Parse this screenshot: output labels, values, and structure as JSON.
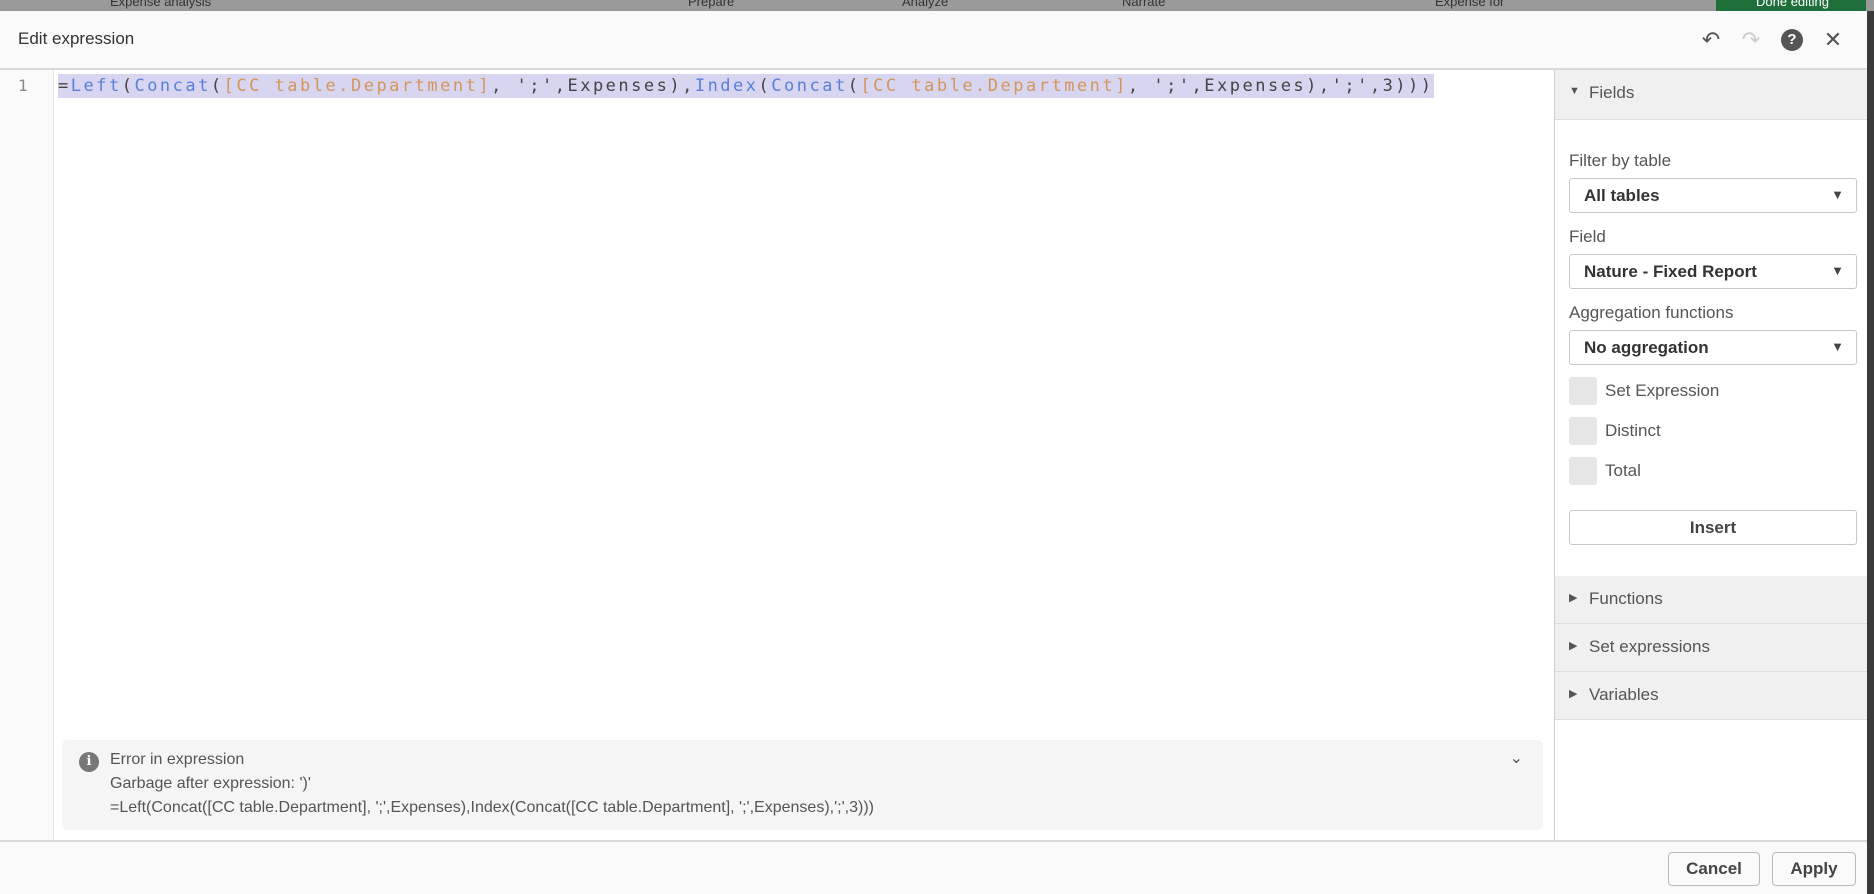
{
  "app_bar": {
    "title": "Expense analysis",
    "tabs": [
      "Prepare",
      "Analyze",
      "Narrate"
    ],
    "sheet": "Expense for",
    "done_label": "Done editing"
  },
  "dialog": {
    "title": "Edit expression",
    "header_icons": [
      "undo-icon",
      "redo-icon",
      "help-icon",
      "close-icon"
    ]
  },
  "editor": {
    "line_number": "1",
    "tokens": [
      {
        "t": "=",
        "c": "str"
      },
      {
        "t": "Left",
        "c": "fn"
      },
      {
        "t": "(",
        "c": "str"
      },
      {
        "t": "Concat",
        "c": "fn"
      },
      {
        "t": "(",
        "c": "str"
      },
      {
        "t": "[CC table.Department]",
        "c": "fld"
      },
      {
        "t": ", ';',Expenses),",
        "c": "str"
      },
      {
        "t": "Index",
        "c": "fn"
      },
      {
        "t": "(",
        "c": "str"
      },
      {
        "t": "Concat",
        "c": "fn"
      },
      {
        "t": "(",
        "c": "str"
      },
      {
        "t": "[CC table.Department]",
        "c": "fld"
      },
      {
        "t": ", ';',Expenses),';',3)))",
        "c": "str"
      }
    ]
  },
  "error": {
    "title": "Error in expression",
    "message": "Garbage after expression: ')'",
    "expression": "=Left(Concat([CC table.Department], ';',Expenses),Index(Concat([CC table.Department], ';',Expenses),';',3)))"
  },
  "panel": {
    "fields_header": "Fields",
    "filter_label": "Filter by table",
    "filter_value": "All tables",
    "field_label": "Field",
    "field_value": "Nature - Fixed Report",
    "aggregation_label": "Aggregation functions",
    "aggregation_value": "No aggregation",
    "checkboxes": [
      {
        "label": "Set Expression",
        "checked": false
      },
      {
        "label": "Distinct",
        "checked": false
      },
      {
        "label": "Total",
        "checked": false
      }
    ],
    "insert_label": "Insert",
    "sections": [
      "Functions",
      "Set expressions",
      "Variables"
    ]
  },
  "footer": {
    "cancel_label": "Cancel",
    "apply_label": "Apply"
  }
}
